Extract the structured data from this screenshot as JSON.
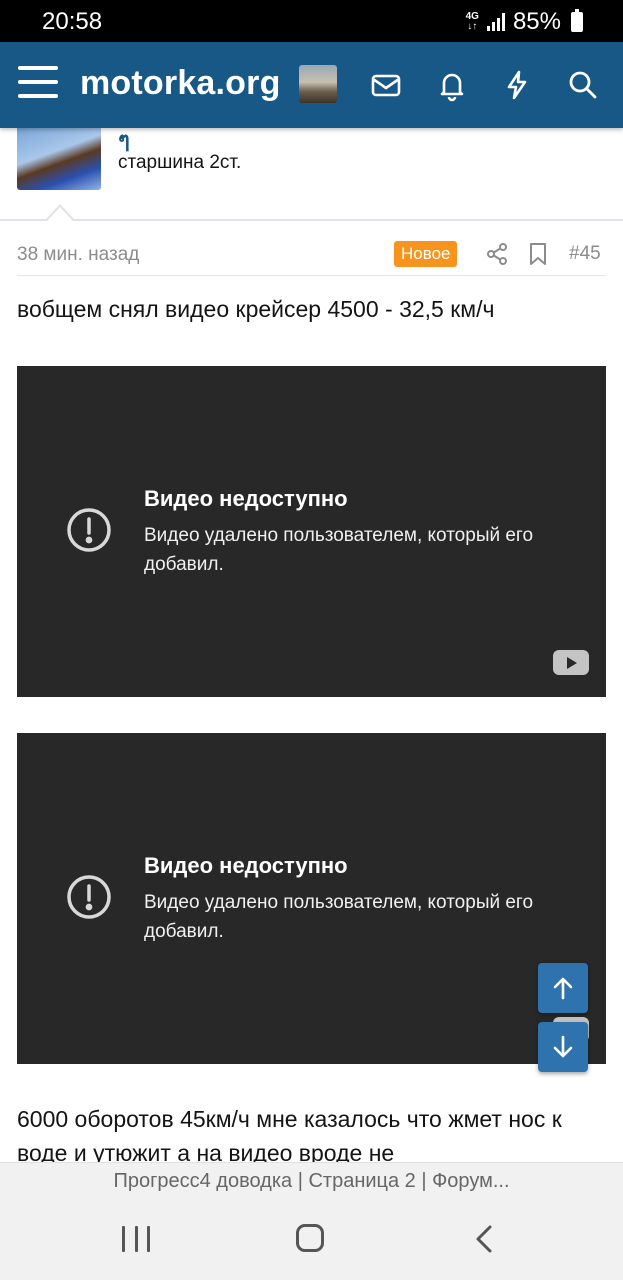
{
  "statusbar": {
    "time": "20:58",
    "network_top": "4G",
    "network_bottom": "↓↑",
    "battery": "85%"
  },
  "header": {
    "logo": "motorka.org"
  },
  "author": {
    "name": "ๆ",
    "rank": "старшина 2ст."
  },
  "post": {
    "time_ago": "38 мин. назад",
    "badge": "Новое",
    "number": "#45",
    "text_top": "вобщем снял видео крейсер 4500 - 32,5 км/ч",
    "text_bottom": "6000 оборотов 45км/ч мне казалось что жмет нос к воде и утюжит а на видео вроде не"
  },
  "videos": [
    {
      "title": "Видео недоступно",
      "message": "Видео удалено пользователем, который его добавил."
    },
    {
      "title": "Видео недоступно",
      "message": "Видео удалено пользователем, который его добавил."
    }
  ],
  "browser": {
    "page_title": "Прогресс4 доводка | Страница 2 | Форум..."
  },
  "colors": {
    "header_bg": "#185886",
    "badge_new": "#f7941d",
    "video_bg": "#282828",
    "scroll_btn": "#2f73ae"
  }
}
